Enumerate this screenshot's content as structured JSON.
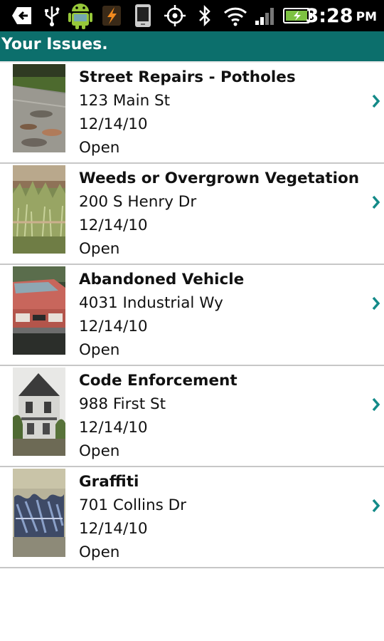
{
  "status_bar": {
    "time": "3:28",
    "ampm": "PM",
    "icons": [
      "back-arrow-icon",
      "usb-icon",
      "android-icon",
      "flash-icon",
      "phone-icon",
      "gps-icon",
      "bluetooth-icon",
      "wifi-icon",
      "signal-icon",
      "battery-icon"
    ]
  },
  "header": {
    "title": "Your Issues."
  },
  "issues": [
    {
      "title": "Street Repairs - Potholes",
      "address": "123 Main St",
      "date": "12/14/10",
      "status": "Open",
      "image": "pothole-photo"
    },
    {
      "title": "Weeds or Overgrown Vegetation",
      "address": "200 S Henry Dr",
      "date": "12/14/10",
      "status": "Open",
      "image": "weeds-photo"
    },
    {
      "title": "Abandoned Vehicle",
      "address": "4031 Industrial Wy",
      "date": "12/14/10",
      "status": "Open",
      "image": "vehicle-photo"
    },
    {
      "title": "Code Enforcement",
      "address": "988 First St",
      "date": "12/14/10",
      "status": "Open",
      "image": "house-photo"
    },
    {
      "title": "Graffiti",
      "address": "701 Collins Dr",
      "date": "12/14/10",
      "status": "Open",
      "image": "graffiti-photo"
    }
  ],
  "colors": {
    "header_bg": "#0c6f6c",
    "chevron": "#138a88",
    "divider": "#c7c7c7"
  }
}
